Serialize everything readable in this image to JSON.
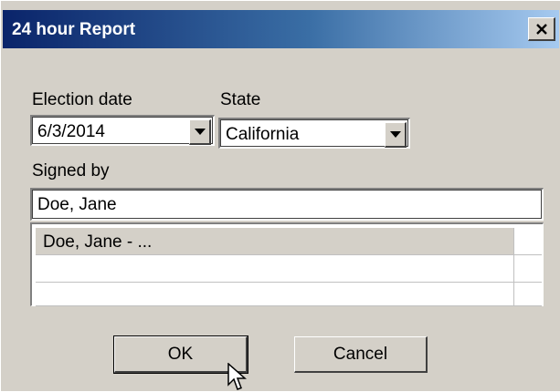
{
  "window": {
    "title": "24 hour Report",
    "close_glyph": "×"
  },
  "fields": {
    "election_date": {
      "label": "Election date",
      "value": "6/3/2014"
    },
    "state": {
      "label": "State",
      "value": "California"
    },
    "signed_by": {
      "label": "Signed by",
      "value": "Doe, Jane"
    }
  },
  "list": {
    "rows": [
      {
        "text": "Doe, Jane - ...",
        "selected": true
      },
      {
        "text": ""
      },
      {
        "text": ""
      }
    ]
  },
  "buttons": {
    "ok": "OK",
    "cancel": "Cancel"
  },
  "icons": {
    "close": "close-icon",
    "dropdown": "chevron-down-icon",
    "cursor": "mouse-pointer-icon"
  },
  "colors": {
    "face": "#d4d0c8",
    "title_start": "#0a246a",
    "title_end": "#a6caf0"
  }
}
